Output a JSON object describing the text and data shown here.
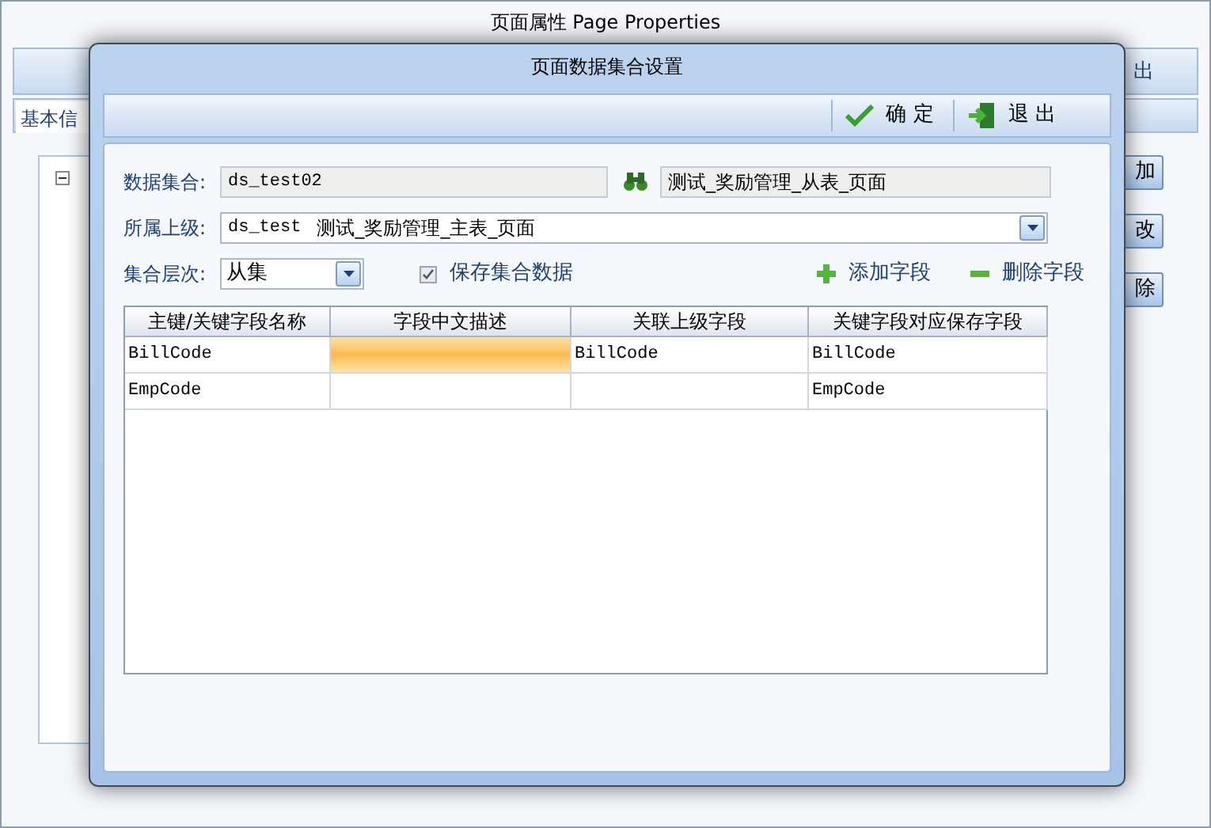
{
  "background_window": {
    "title": "页面属性  Page Properties",
    "toolbar_button": "出",
    "tab": "基本信",
    "side_buttons": [
      "加",
      "改",
      "除"
    ]
  },
  "dialog": {
    "title": "页面数据集合设置",
    "toolbar": [
      {
        "kind": "confirm",
        "label": "确 定"
      },
      {
        "kind": "exit",
        "label": "退 出"
      }
    ],
    "dataset": {
      "label": "数据集合:",
      "value": "ds_test02",
      "description": "测试_奖励管理_从表_页面"
    },
    "parent": {
      "label": "所属上级:",
      "value": "ds_test",
      "description": "测试_奖励管理_主表_页面"
    },
    "level": {
      "label": "集合层次:",
      "value": "从集"
    },
    "save_checkbox": {
      "label": "保存集合数据",
      "checked": true
    },
    "actions": [
      {
        "kind": "add",
        "label": "添加字段"
      },
      {
        "kind": "remove",
        "label": "删除字段"
      }
    ],
    "table": {
      "columns": [
        "主键/关键字段名称",
        "字段中文描述",
        "关联上级字段",
        "关键字段对应保存字段"
      ],
      "rows": [
        {
          "cells": [
            {
              "text": "BillCode",
              "selected": false
            },
            {
              "text": "",
              "selected": true
            },
            {
              "text": "BillCode",
              "selected": false
            },
            {
              "text": "BillCode",
              "selected": false
            }
          ]
        },
        {
          "cells": [
            {
              "text": "EmpCode",
              "selected": false
            },
            {
              "text": "",
              "selected": false
            },
            {
              "text": "",
              "selected": false
            },
            {
              "text": "EmpCode",
              "selected": false
            }
          ]
        }
      ]
    }
  }
}
